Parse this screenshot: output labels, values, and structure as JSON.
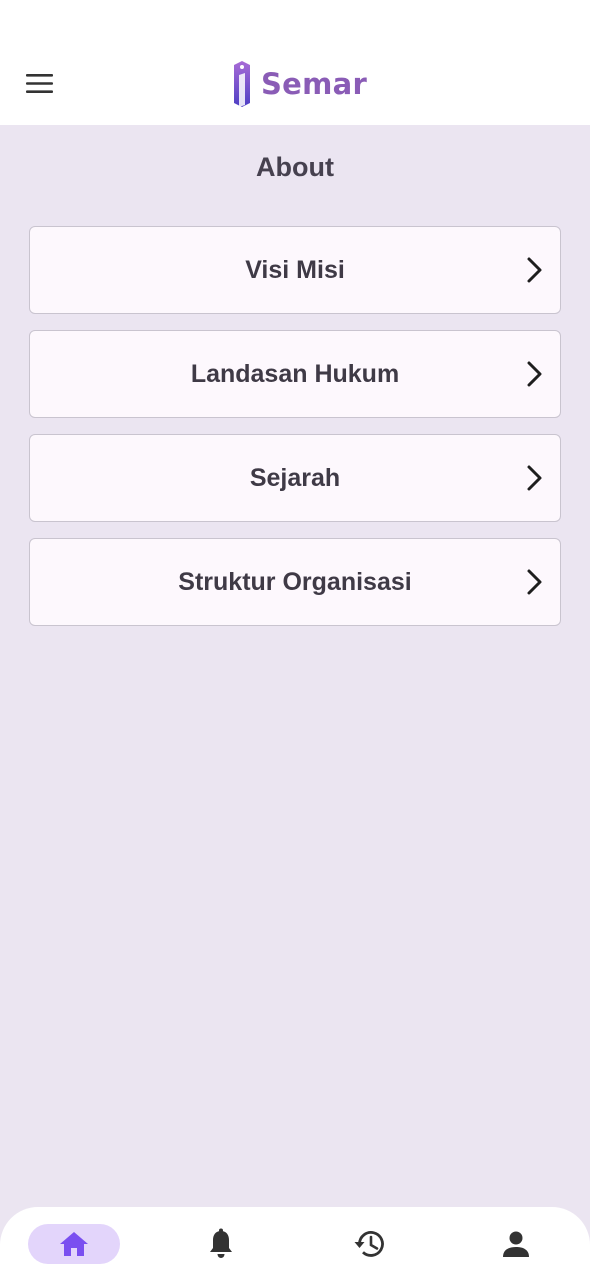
{
  "header": {
    "app_name": "Semar",
    "menu_icon": "hamburger-menu-icon",
    "logo_icon": "tag-logo-icon"
  },
  "page": {
    "title": "About"
  },
  "menu_items": [
    {
      "label": "Visi Misi",
      "icon": "chevron-right-icon"
    },
    {
      "label": "Landasan Hukum",
      "icon": "chevron-right-icon"
    },
    {
      "label": "Sejarah",
      "icon": "chevron-right-icon"
    },
    {
      "label": "Struktur Organisasi",
      "icon": "chevron-right-icon"
    }
  ],
  "bottom_nav": {
    "items": [
      {
        "icon": "home-icon",
        "active": true
      },
      {
        "icon": "bell-icon",
        "active": false
      },
      {
        "icon": "history-icon",
        "active": false
      },
      {
        "icon": "person-icon",
        "active": false
      }
    ]
  },
  "colors": {
    "accent": "#7a4ff0",
    "brand": "#8a5cb6",
    "background": "#ebe5f1",
    "card": "#fdf8fd",
    "active_pill": "#e3d5fb"
  }
}
